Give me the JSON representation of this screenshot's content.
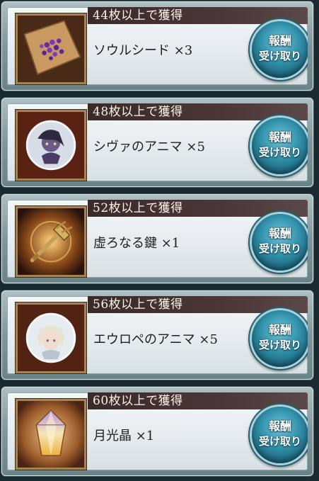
{
  "claim_button": {
    "line1": "報酬",
    "line2": "受け取り"
  },
  "rewards": [
    {
      "threshold": "44枚以上で獲得",
      "item": "ソウルシード ×3",
      "icon": "soul-seed-icon"
    },
    {
      "threshold": "48枚以上で獲得",
      "item": "シヴァのアニマ ×5",
      "icon": "shiva-anima-icon"
    },
    {
      "threshold": "52枚以上で獲得",
      "item": "虚ろなる鍵 ×1",
      "icon": "hollow-key-icon"
    },
    {
      "threshold": "56枚以上で獲得",
      "item": "エウロペのアニマ ×5",
      "icon": "europa-anima-icon"
    },
    {
      "threshold": "60枚以上で獲得",
      "item": "月光晶 ×1",
      "icon": "moonlight-crystal-icon"
    }
  ]
}
